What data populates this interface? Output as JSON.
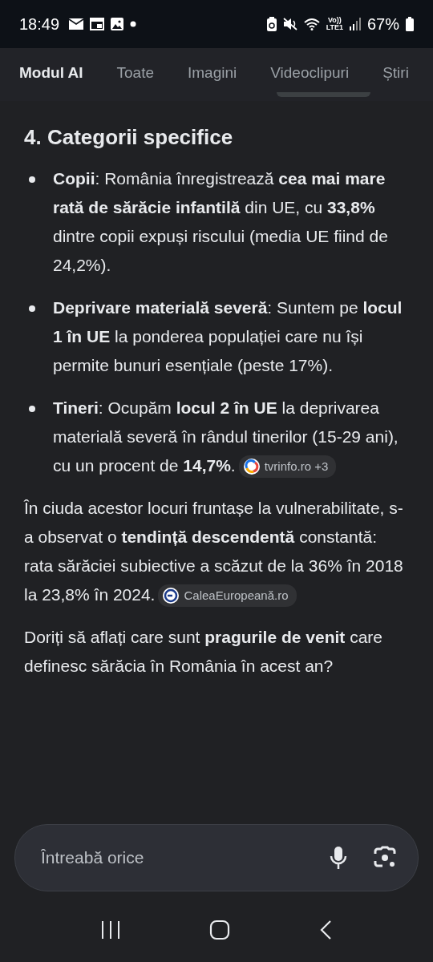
{
  "status_bar": {
    "time": "18:49",
    "volte_label": "Vo))",
    "network_label": "LTE1",
    "battery": "67%"
  },
  "tabs": [
    {
      "label": "Modul AI",
      "selected": true
    },
    {
      "label": "Toate",
      "selected": false
    },
    {
      "label": "Imagini",
      "selected": false
    },
    {
      "label": "Videoclipuri",
      "selected": false
    },
    {
      "label": "Știri",
      "selected": false
    }
  ],
  "answer": {
    "heading": "4. Categorii specifice",
    "bullets": [
      {
        "text": "**Copii**: România înregistrează **cea mai mare rată de sărăcie infantilă** din UE, cu **33,8%** dintre copii expuși riscului (media UE fiind de 24,2%)."
      },
      {
        "text": "**Deprivare materială severă**: Suntem pe **locul 1 în UE** la ponderea populației care nu își permite bunuri esențiale (peste 17%)."
      },
      {
        "text": "**Tineri**: Ocupăm **locul 2 în UE** la deprivarea materială severă în rândul tinerilor (15-29 ani), cu un procent de **14,7%**.",
        "citation": {
          "label": "tvrinfo.ro +3",
          "kind": "swirl"
        }
      }
    ],
    "paragraphs": [
      {
        "text": "În ciuda acestor locuri fruntașe la vulnerabilitate, s-a observat o **tendință descendentă** constantă: rata sărăciei subiective a scăzut de la 36% în 2018 la 23,8% în 2024.",
        "citation": {
          "label": "CaleaEuropeană.ro",
          "kind": "circle"
        }
      },
      {
        "text": "Doriți să aflați care sunt **pragurile de venit** care definesc sărăcia în România în acest an?"
      }
    ]
  },
  "search": {
    "placeholder": "Întreabă orice"
  }
}
